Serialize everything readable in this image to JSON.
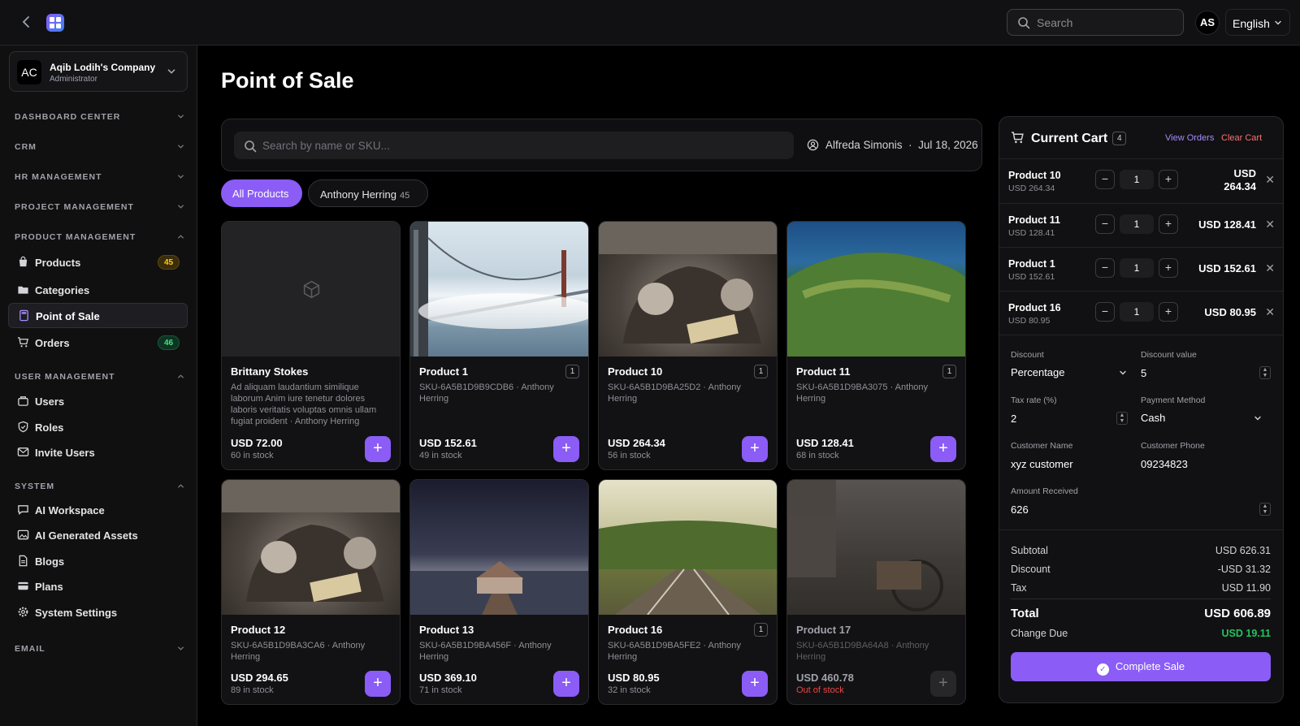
{
  "topbar": {
    "search_placeholder": "Search",
    "avatar": "AS",
    "language": "English"
  },
  "company": {
    "initials": "AC",
    "name": "Aqib Lodih's Company",
    "role": "Administrator"
  },
  "sidebar": {
    "sections": [
      {
        "label": "DASHBOARD CENTER"
      },
      {
        "label": "CRM"
      },
      {
        "label": "HR MANAGEMENT"
      },
      {
        "label": "PROJECT MANAGEMENT"
      },
      {
        "label": "PRODUCT MANAGEMENT"
      },
      {
        "label": "USER MANAGEMENT"
      },
      {
        "label": "SYSTEM"
      },
      {
        "label": "EMAIL"
      }
    ],
    "items": [
      {
        "label": "Products",
        "badge": "45"
      },
      {
        "label": "Categories"
      },
      {
        "label": "Point of Sale"
      },
      {
        "label": "Orders",
        "badge": "46"
      },
      {
        "label": "Users"
      },
      {
        "label": "Roles"
      },
      {
        "label": "Invite Users"
      },
      {
        "label": "AI Workspace"
      },
      {
        "label": "AI Generated Assets"
      },
      {
        "label": "Blogs"
      },
      {
        "label": "Plans"
      },
      {
        "label": "System Settings"
      }
    ]
  },
  "page": {
    "title": "Point of Sale"
  },
  "pos": {
    "search_placeholder": "Search by name or SKU...",
    "cashier": "Alfreda Simonis",
    "separator": "·",
    "date": "Jul 18, 2026",
    "chips": [
      {
        "label": "All Products"
      },
      {
        "label": "Anthony Herring",
        "count": "45"
      }
    ]
  },
  "products": [
    {
      "name": "Brittany Stokes",
      "desc": "Ad aliquam laudantium similique laborum Anim iure tenetur dolores laboris veritatis voluptas omnis ullam fugiat proident · Anthony Herring",
      "price": "USD 72.00",
      "stock": "60 in stock"
    },
    {
      "name": "Product 1",
      "qty": "1",
      "desc": "SKU-6A5B1D9B9CDB6 · Anthony Herring",
      "price": "USD 152.61",
      "stock": "49 in stock"
    },
    {
      "name": "Product 10",
      "qty": "1",
      "desc": "SKU-6A5B1D9BA25D2 · Anthony Herring",
      "price": "USD 264.34",
      "stock": "56 in stock"
    },
    {
      "name": "Product 11",
      "qty": "1",
      "desc": "SKU-6A5B1D9BA3075 · Anthony Herring",
      "price": "USD 128.41",
      "stock": "68 in stock"
    },
    {
      "name": "Product 12",
      "desc": "SKU-6A5B1D9BA3CA6 · Anthony Herring",
      "price": "USD 294.65",
      "stock": "89 in stock"
    },
    {
      "name": "Product 13",
      "desc": "SKU-6A5B1D9BA456F · Anthony Herring",
      "price": "USD 369.10",
      "stock": "71 in stock"
    },
    {
      "name": "Product 16",
      "qty": "1",
      "desc": "SKU-6A5B1D9BA5FE2 · Anthony Herring",
      "price": "USD 80.95",
      "stock": "32 in stock"
    },
    {
      "name": "Product 17",
      "desc": "SKU-6A5B1D9BA64A8 · Anthony Herring",
      "price": "USD 460.78",
      "stock": "Out of stock"
    }
  ],
  "cart": {
    "title": "Current Cart",
    "count": "4",
    "view_orders": "View Orders",
    "clear_cart": "Clear Cart",
    "items": [
      {
        "name": "Product 10",
        "unit": "USD 264.34",
        "qty": "1",
        "total_line1": "USD",
        "total_line2": "264.34"
      },
      {
        "name": "Product 11",
        "unit": "USD 128.41",
        "qty": "1",
        "total": "USD 128.41"
      },
      {
        "name": "Product 1",
        "unit": "USD 152.61",
        "qty": "1",
        "total": "USD 152.61"
      },
      {
        "name": "Product 16",
        "unit": "USD 80.95",
        "qty": "1",
        "total": "USD 80.95"
      }
    ],
    "fields": {
      "discount_label": "Discount",
      "discount": "Percentage",
      "discount_value_label": "Discount value",
      "discount_value": "5",
      "tax_label": "Tax rate (%)",
      "tax": "2",
      "payment_label": "Payment Method",
      "payment": "Cash",
      "customer_name_label": "Customer Name",
      "customer_name": "xyz customer",
      "customer_phone_label": "Customer Phone",
      "customer_phone": "09234823",
      "amount_label": "Amount Received",
      "amount": "626"
    },
    "summary": {
      "subtotal_label": "Subtotal",
      "subtotal": "USD 626.31",
      "discount_label": "Discount",
      "discount": "-USD 31.32",
      "tax_label": "Tax",
      "tax": "USD 11.90",
      "total_label": "Total",
      "total": "USD 606.89",
      "change_label": "Change Due",
      "change": "USD 19.11"
    },
    "complete_label": "Complete Sale"
  },
  "colors": {
    "accent": "#8b5cf6",
    "success": "#22c55e",
    "danger": "#ef4444"
  }
}
